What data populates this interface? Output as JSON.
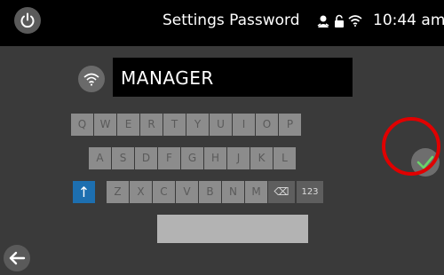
{
  "header": {
    "title": "Settings Password",
    "time": "10:44 am",
    "status_icons": [
      "person-icon",
      "unlocked-lock-icon",
      "wifi-icon"
    ]
  },
  "password_field": {
    "value": "MANAGER",
    "icon": "wifi-icon"
  },
  "keyboard": {
    "row1": [
      "Q",
      "W",
      "E",
      "R",
      "T",
      "Y",
      "U",
      "I",
      "O",
      "P"
    ],
    "row2": [
      "A",
      "S",
      "D",
      "F",
      "G",
      "H",
      "J",
      "K",
      "L"
    ],
    "row3": [
      "Z",
      "X",
      "C",
      "V",
      "B",
      "N",
      "M"
    ],
    "shift_glyph": "↑",
    "backspace_glyph": "⌫",
    "numeric_label": "123"
  },
  "buttons": {
    "confirm_icon": "checkmark-icon",
    "back_icon": "back-arrow-icon",
    "power_icon": "power-icon"
  },
  "colors": {
    "shift_active": "#1d6fb0",
    "confirm_check": "#6ad46a",
    "highlight_ring": "#e00000"
  }
}
